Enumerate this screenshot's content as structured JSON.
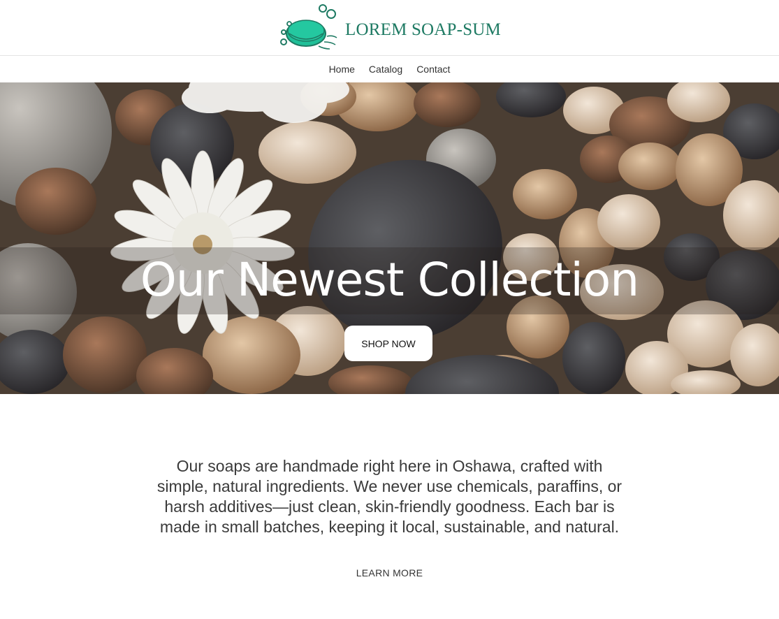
{
  "brand": {
    "name": "LOREM SOAP-SUM",
    "accent_color": "#1e7a63",
    "soap_color": "#1fbf98",
    "logo_icon": "soap-bar-bubbles-icon"
  },
  "nav": {
    "items": [
      {
        "label": "Home"
      },
      {
        "label": "Catalog"
      },
      {
        "label": "Contact"
      }
    ]
  },
  "hero": {
    "title": "Our Newest Collection",
    "cta_label": "SHOP NOW",
    "background": "river stones and white chrysanthemum flowers photo"
  },
  "about": {
    "text": "Our soaps are handmade right here in Oshawa, crafted with simple, natural ingredients. We never use chemicals, paraffins, or harsh additives—just clean, skin-friendly goodness. Each bar is made in small batches, keeping it local, sustainable, and natural.",
    "link_label": "LEARN MORE"
  }
}
